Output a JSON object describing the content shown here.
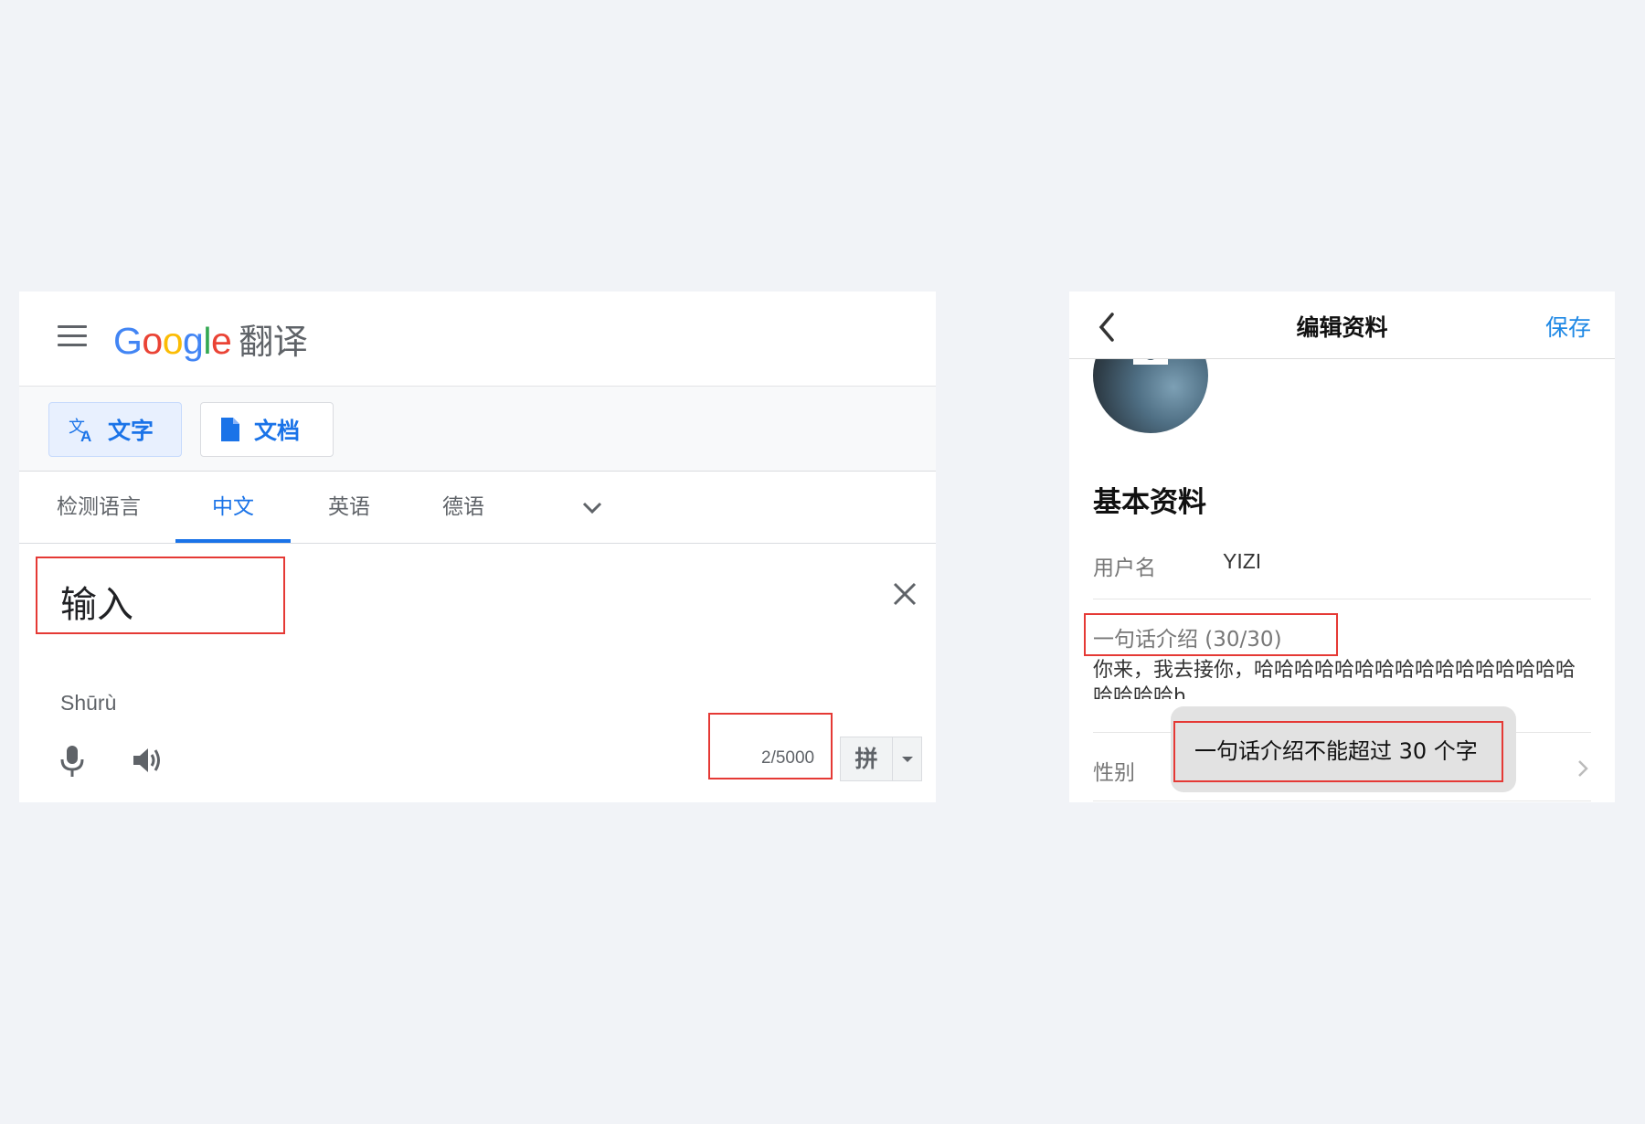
{
  "translate_panel": {
    "logo": {
      "letters": [
        "G",
        "o",
        "o",
        "g",
        "l",
        "e"
      ],
      "product": "翻译"
    },
    "modes": {
      "text_label": "文字",
      "document_label": "文档"
    },
    "languages": [
      {
        "label": "检测语言",
        "active": false
      },
      {
        "label": "中文",
        "active": true
      },
      {
        "label": "英语",
        "active": false
      },
      {
        "label": "德语",
        "active": false
      }
    ],
    "input_text": "输入",
    "romanization": "Shūrù",
    "char_count": "2/5000",
    "ime_label": "拼",
    "icons": [
      "menu-icon",
      "translate-icon",
      "document-icon",
      "chevron-down-icon",
      "close-icon",
      "mic-icon",
      "speaker-icon"
    ]
  },
  "profile_panel": {
    "title": "编辑资料",
    "save_label": "保存",
    "section_title": "基本资料",
    "username": {
      "label": "用户名",
      "value": "YIZI"
    },
    "bio": {
      "label": "一句话介绍 (30/30)",
      "text": "你来，我去接你，哈哈哈哈哈哈哈哈哈哈哈哈哈哈哈哈哈哈哈哈h"
    },
    "gender": {
      "label": "性别"
    },
    "toast": "一句话介绍不能超过 30 个字",
    "icons": [
      "back-icon",
      "camera-icon",
      "chevron-right-icon"
    ]
  },
  "colors": {
    "accent_blue": "#1a73e8",
    "highlight_red": "#e53935",
    "ios_blue": "#1e88e5"
  }
}
